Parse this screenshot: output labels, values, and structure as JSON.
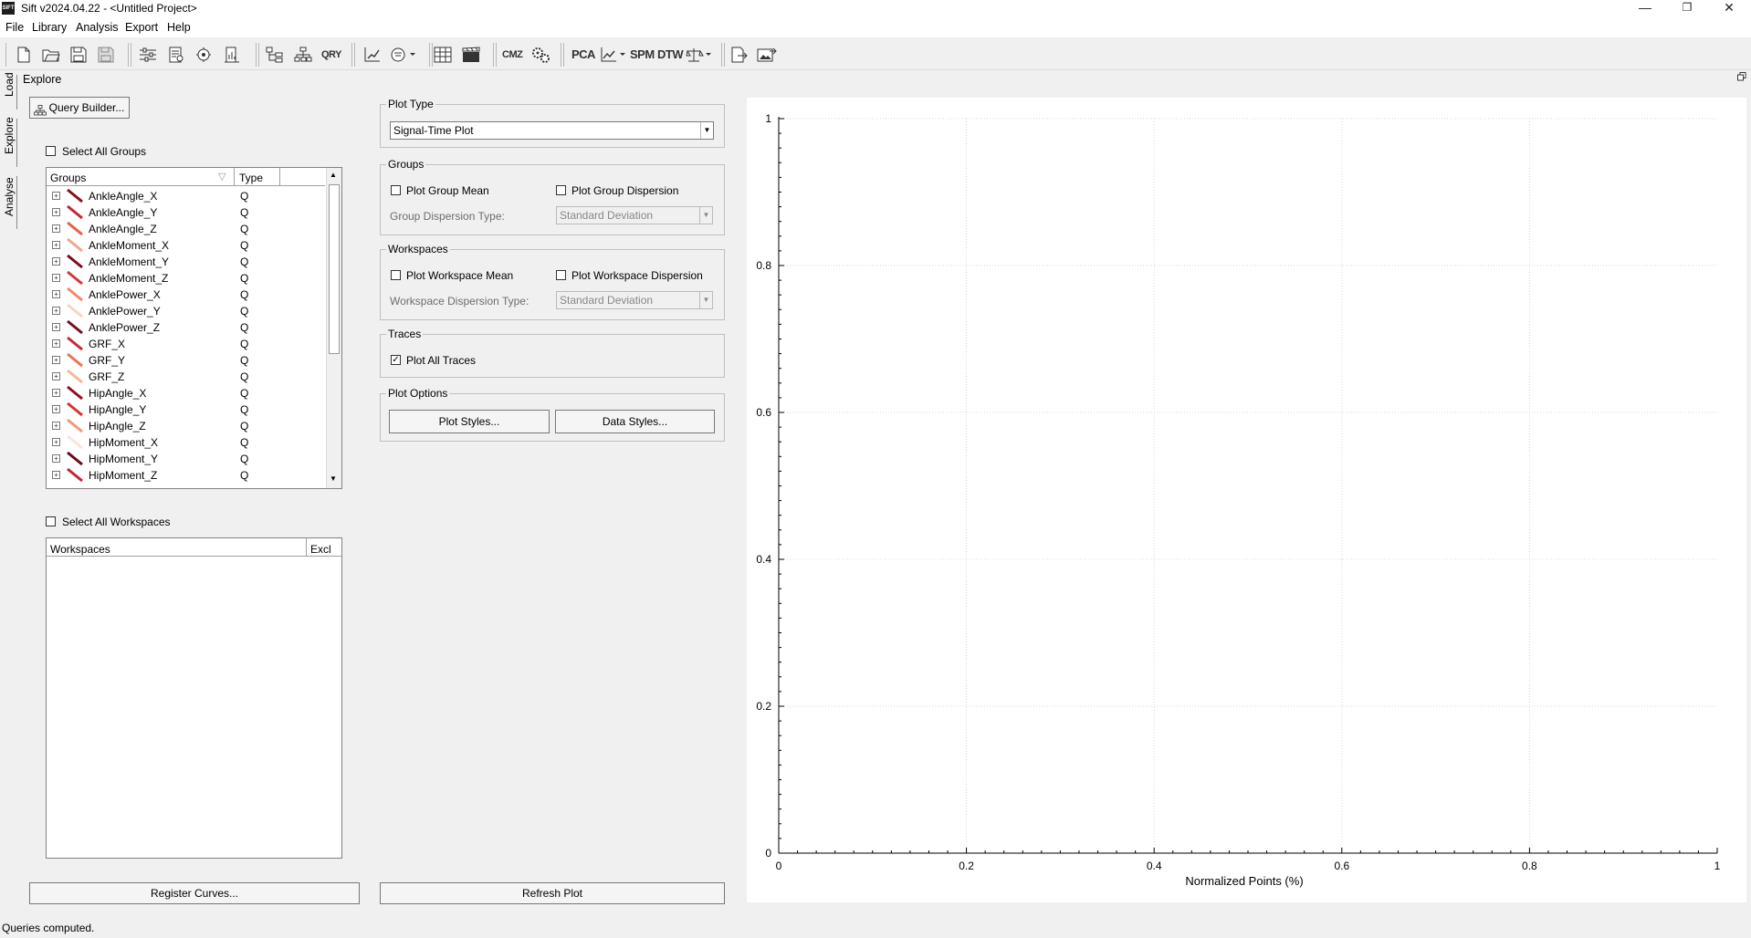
{
  "window": {
    "title": "Sift v2024.04.22 - <Untitled Project>",
    "app_icon_text": "SIFT",
    "minimize": "—",
    "maximize": "❐",
    "close": "✕"
  },
  "menu": [
    {
      "label": "File"
    },
    {
      "label": "Library"
    },
    {
      "label": "Analysis"
    },
    {
      "label": "Export"
    },
    {
      "label": "Help"
    }
  ],
  "toolbar": {
    "pca": "PCA",
    "spm": "SPM",
    "dtw": "DTW",
    "qry": "QRY",
    "cmz": "CMZ"
  },
  "side_tabs": [
    "Load",
    "Explore",
    "Analyse"
  ],
  "panel_title": "Explore",
  "query_builder_label": "Query Builder...",
  "select_all_groups": "Select All Groups",
  "groups_table": {
    "col_groups": "Groups",
    "col_type": "Type",
    "rows": [
      {
        "name": "AnkleAngle_X",
        "type": "Q",
        "color": "#8b0f1a"
      },
      {
        "name": "AnkleAngle_Y",
        "type": "Q",
        "color": "#c4283a"
      },
      {
        "name": "AnkleAngle_Z",
        "type": "Q",
        "color": "#e8604a"
      },
      {
        "name": "AnkleMoment_X",
        "type": "Q",
        "color": "#f1a88a"
      },
      {
        "name": "AnkleMoment_Y",
        "type": "Q",
        "color": "#7f0c1c"
      },
      {
        "name": "AnkleMoment_Z",
        "type": "Q",
        "color": "#d23a3c"
      },
      {
        "name": "AnklePower_X",
        "type": "Q",
        "color": "#f08a6a"
      },
      {
        "name": "AnklePower_Y",
        "type": "Q",
        "color": "#f8d4c4"
      },
      {
        "name": "AnklePower_Z",
        "type": "Q",
        "color": "#76101f"
      },
      {
        "name": "GRF_X",
        "type": "Q",
        "color": "#c82a36"
      },
      {
        "name": "GRF_Y",
        "type": "Q",
        "color": "#ee7357"
      },
      {
        "name": "GRF_Z",
        "type": "Q",
        "color": "#f5b69c"
      },
      {
        "name": "HipAngle_X",
        "type": "Q",
        "color": "#8e1120"
      },
      {
        "name": "HipAngle_Y",
        "type": "Q",
        "color": "#d03537"
      },
      {
        "name": "HipAngle_Z",
        "type": "Q",
        "color": "#f29a7a"
      },
      {
        "name": "HipMoment_X",
        "type": "Q",
        "color": "#fbe4da"
      },
      {
        "name": "HipMoment_Y",
        "type": "Q",
        "color": "#690b1a"
      },
      {
        "name": "HipMoment_Z",
        "type": "Q",
        "color": "#c32634"
      }
    ]
  },
  "select_all_workspaces": "Select All Workspaces",
  "workspaces_table": {
    "col_workspaces": "Workspaces",
    "col_excl": "Excl"
  },
  "register_curves": "Register Curves...",
  "refresh_plot": "Refresh Plot",
  "plot_type": {
    "label": "Plot Type",
    "value": "Signal-Time Plot"
  },
  "groups_box": {
    "label": "Groups",
    "mean": "Plot Group Mean",
    "dispersion": "Plot Group Dispersion",
    "disp_type_label": "Group Dispersion Type:",
    "disp_type_value": "Standard Deviation"
  },
  "workspaces_box": {
    "label": "Workspaces",
    "mean": "Plot Workspace Mean",
    "dispersion": "Plot Workspace Dispersion",
    "disp_type_label": "Workspace Dispersion Type:",
    "disp_type_value": "Standard Deviation"
  },
  "traces_box": {
    "label": "Traces",
    "plot_all": "Plot All Traces",
    "plot_all_checked": true
  },
  "plot_options": {
    "label": "Plot Options",
    "plot_styles": "Plot Styles...",
    "data_styles": "Data Styles..."
  },
  "chart_data": {
    "type": "line",
    "series": [],
    "xlabel": "Normalized Points (%)",
    "ylabel": "",
    "xlim": [
      0,
      1
    ],
    "ylim": [
      0,
      1
    ],
    "x_ticks": [
      "0",
      "0.2",
      "0.4",
      "0.6",
      "0.8",
      "1"
    ],
    "y_ticks": [
      "0",
      "0.2",
      "0.4",
      "0.6",
      "0.8",
      "1"
    ],
    "grid": true
  },
  "status": "Queries computed."
}
